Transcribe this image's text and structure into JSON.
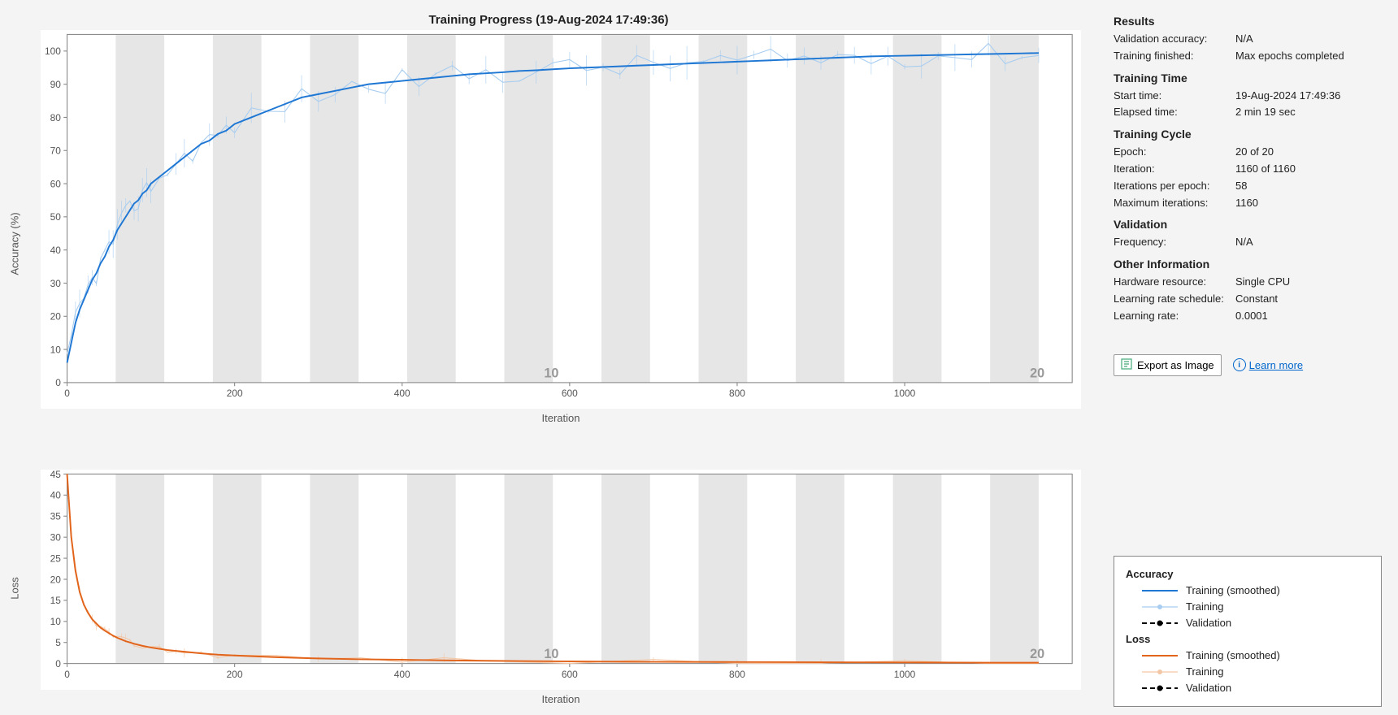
{
  "title": "Training Progress (19-Aug-2024 17:49:36)",
  "axes": {
    "acc": {
      "ylabel": "Accuracy (%)",
      "xlabel": "Iteration",
      "x": [
        0,
        200,
        400,
        600,
        800,
        1000
      ],
      "y": [
        0,
        10,
        20,
        30,
        40,
        50,
        60,
        70,
        80,
        90,
        100
      ],
      "xmax": 1200,
      "ymax": 105,
      "epoch_marks": [
        {
          "x": 580,
          "label": "10"
        },
        {
          "x": 1160,
          "label": "20"
        }
      ]
    },
    "loss": {
      "ylabel": "Loss",
      "xlabel": "Iteration",
      "x": [
        0,
        200,
        400,
        600,
        800,
        1000
      ],
      "y": [
        0,
        5,
        10,
        15,
        20,
        25,
        30,
        35,
        40,
        45
      ],
      "xmax": 1200,
      "ymax": 45,
      "epoch_marks": [
        {
          "x": 580,
          "label": "10"
        },
        {
          "x": 1160,
          "label": "20"
        }
      ]
    }
  },
  "panel": {
    "results": {
      "h": "Results",
      "rows": [
        [
          "Validation accuracy:",
          "N/A"
        ],
        [
          "Training finished:",
          "Max epochs completed"
        ]
      ]
    },
    "time": {
      "h": "Training Time",
      "rows": [
        [
          "Start time:",
          "19-Aug-2024 17:49:36"
        ],
        [
          "Elapsed time:",
          "2 min 19 sec"
        ]
      ]
    },
    "cycle": {
      "h": "Training Cycle",
      "rows": [
        [
          "Epoch:",
          "20 of 20"
        ],
        [
          "Iteration:",
          "1160 of 1160"
        ],
        [
          "Iterations per epoch:",
          "58"
        ],
        [
          "Maximum iterations:",
          "1160"
        ]
      ]
    },
    "valid": {
      "h": "Validation",
      "rows": [
        [
          "Frequency:",
          "N/A"
        ]
      ]
    },
    "other": {
      "h": "Other Information",
      "rows": [
        [
          "Hardware resource:",
          "Single CPU"
        ],
        [
          "Learning rate schedule:",
          "Constant"
        ],
        [
          "Learning rate:",
          "0.0001"
        ]
      ]
    }
  },
  "buttons": {
    "export": "Export as Image",
    "learn": "Learn more"
  },
  "legend": {
    "acc_h": "Accuracy",
    "loss_h": "Loss",
    "smoothed": "Training (smoothed)",
    "training": "Training",
    "validation": "Validation"
  },
  "chart_data": [
    {
      "type": "line",
      "title": "Accuracy (%)",
      "xlabel": "Iteration",
      "ylabel": "Accuracy (%)",
      "xlim": [
        0,
        1200
      ],
      "ylim": [
        0,
        105
      ],
      "series": [
        {
          "name": "Training (smoothed)",
          "color": "#1f77d4",
          "x": [
            0,
            5,
            10,
            15,
            20,
            25,
            30,
            35,
            40,
            45,
            50,
            55,
            60,
            65,
            70,
            75,
            80,
            85,
            90,
            95,
            100,
            110,
            120,
            130,
            140,
            150,
            160,
            170,
            180,
            190,
            200,
            220,
            240,
            260,
            280,
            300,
            320,
            340,
            360,
            380,
            400,
            420,
            440,
            460,
            480,
            500,
            520,
            540,
            560,
            580,
            600,
            620,
            640,
            660,
            680,
            700,
            720,
            740,
            760,
            780,
            800,
            820,
            840,
            860,
            880,
            900,
            920,
            940,
            960,
            980,
            1000,
            1020,
            1040,
            1060,
            1080,
            1100,
            1120,
            1140,
            1160
          ],
          "y": [
            6,
            12,
            18,
            22,
            25,
            28,
            31,
            33,
            36,
            38,
            41,
            43,
            46,
            48,
            50,
            52,
            54,
            55,
            57,
            58,
            60,
            62,
            64,
            66,
            68,
            70,
            72,
            73,
            75,
            76,
            78,
            80,
            82,
            84,
            86,
            87,
            88,
            89,
            90,
            90.5,
            91,
            91.5,
            92,
            92.5,
            93,
            93.3,
            93.6,
            94,
            94.2,
            94.5,
            94.8,
            95,
            95.2,
            95.4,
            95.6,
            95.8,
            96,
            96.2,
            96.4,
            96.6,
            96.8,
            97,
            97.2,
            97.4,
            97.6,
            97.8,
            98,
            98.2,
            98.4,
            98.5,
            98.6,
            98.7,
            98.8,
            98.9,
            99,
            99.1,
            99.2,
            99.3,
            99.4
          ]
        }
      ]
    },
    {
      "type": "line",
      "title": "Loss",
      "xlabel": "Iteration",
      "ylabel": "Loss",
      "xlim": [
        0,
        1200
      ],
      "ylim": [
        0,
        45
      ],
      "series": [
        {
          "name": "Training (smoothed)",
          "color": "#e2641b",
          "x": [
            0,
            5,
            10,
            15,
            20,
            25,
            30,
            35,
            40,
            45,
            50,
            55,
            60,
            65,
            70,
            75,
            80,
            90,
            100,
            110,
            120,
            130,
            140,
            150,
            160,
            180,
            200,
            250,
            300,
            350,
            400,
            450,
            500,
            600,
            700,
            800,
            900,
            1000,
            1100,
            1160
          ],
          "y": [
            45,
            30,
            22,
            17,
            14,
            12,
            10.5,
            9.5,
            8.5,
            7.8,
            7.2,
            6.6,
            6.1,
            5.7,
            5.3,
            5,
            4.7,
            4.2,
            3.8,
            3.5,
            3.2,
            3,
            2.8,
            2.6,
            2.4,
            2.1,
            1.9,
            1.5,
            1.2,
            1.0,
            0.9,
            0.75,
            0.65,
            0.5,
            0.4,
            0.35,
            0.3,
            0.25,
            0.2,
            0.2
          ]
        }
      ]
    }
  ]
}
